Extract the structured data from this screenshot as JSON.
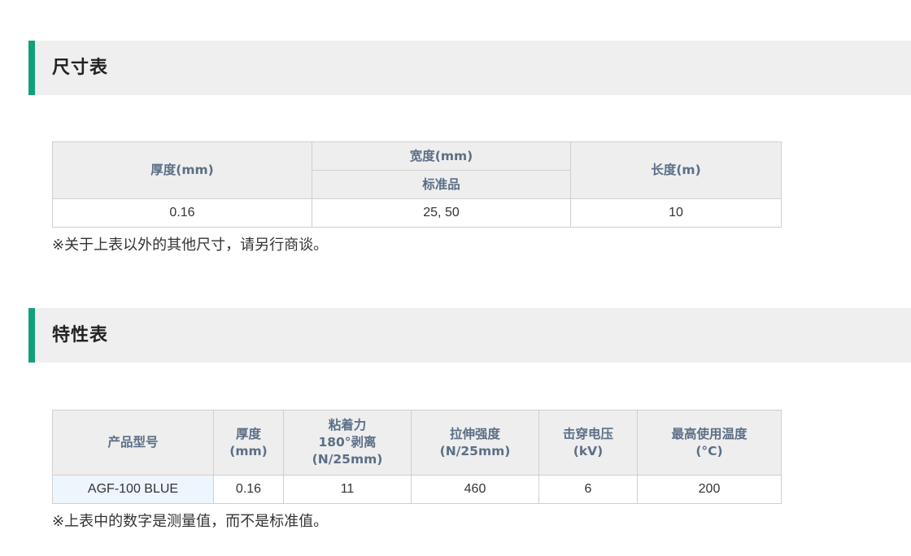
{
  "size_section": {
    "title": "尺寸表",
    "headers": {
      "thickness": "厚度(mm)",
      "width": "宽度(mm)",
      "width_sub": "标准品",
      "length": "长度(m)"
    },
    "row": {
      "thickness": "0.16",
      "width": "25, 50",
      "length": "10"
    },
    "note": "※关于上表以外的其他尺寸，请另行商谈。"
  },
  "property_section": {
    "title": "特性表",
    "headers": {
      "model": "产品型号",
      "thickness_1": "厚度",
      "thickness_2": "(mm)",
      "adhesion_1": "粘着力",
      "adhesion_2": "180°剥离",
      "adhesion_3": "(N/25mm)",
      "tensile_1": "拉伸强度",
      "tensile_2": "(N/25mm)",
      "breakdown_1": "击穿电压",
      "breakdown_2": "(kV)",
      "temp_1": "最高使用温度",
      "temp_2": "(°C)"
    },
    "row": {
      "model": "AGF-100 BLUE",
      "thickness": "0.16",
      "adhesion": "11",
      "tensile": "460",
      "breakdown": "6",
      "temp": "200"
    },
    "note": "※上表中的数字是测量值，而不是标准值。"
  },
  "colors": {
    "accent": "#12a07a",
    "header_bg": "#efefef",
    "table_header_bg": "#eeeeee",
    "table_header_text": "#5b6f86",
    "model_cell_bg": "#eef6fd"
  }
}
